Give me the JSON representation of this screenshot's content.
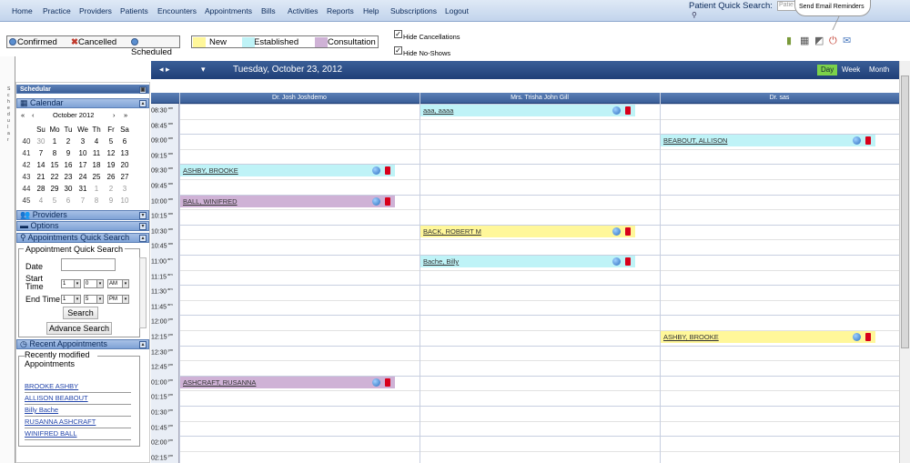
{
  "nav": {
    "items": [
      "Home",
      "Practice",
      "Providers",
      "Patients",
      "Encounters",
      "Appointments",
      "Bills",
      "Activities",
      "Reports",
      "Help",
      "Subscriptions",
      "Logout"
    ]
  },
  "patient_quick_search": {
    "label": "Patient Quick Search:",
    "placeholder": "Patie"
  },
  "tooltip": "Send Email Reminders",
  "legend_status": {
    "confirmed": "Confirmed",
    "cancelled": "Cancelled",
    "scheduled": "Scheduled"
  },
  "legend_types": {
    "new": "New",
    "established": "Established",
    "consultation": "Consultation"
  },
  "hide_cancellations": "Hide Cancellations",
  "hide_noshows": "Hide No-Shows",
  "left_strip_letters": [
    "S",
    "c",
    "h",
    "e",
    "d",
    "u",
    "l",
    "a",
    "r"
  ],
  "panel": {
    "scheduler": "Schedular",
    "calendar": "Calendar",
    "providers": "Providers",
    "options": "Options",
    "aqs": "Appointments Quick Search",
    "recent": "Recent Appointments"
  },
  "calendar": {
    "month": "October 2012",
    "nav": [
      "«",
      "‹",
      "›",
      "»"
    ],
    "days": [
      "Su",
      "Mo",
      "Tu",
      "We",
      "Th",
      "Fr",
      "Sa"
    ],
    "weeks": [
      {
        "wk": "40",
        "d": [
          "30",
          "1",
          "2",
          "3",
          "4",
          "5",
          "6"
        ]
      },
      {
        "wk": "41",
        "d": [
          "7",
          "8",
          "9",
          "10",
          "11",
          "12",
          "13"
        ]
      },
      {
        "wk": "42",
        "d": [
          "14",
          "15",
          "16",
          "17",
          "18",
          "19",
          "20"
        ]
      },
      {
        "wk": "43",
        "d": [
          "21",
          "22",
          "23",
          "24",
          "25",
          "26",
          "27"
        ]
      },
      {
        "wk": "44",
        "d": [
          "28",
          "29",
          "30",
          "31",
          "1",
          "2",
          "3"
        ]
      },
      {
        "wk": "45",
        "d": [
          "4",
          "5",
          "6",
          "7",
          "8",
          "9",
          "10"
        ]
      }
    ]
  },
  "quick_search": {
    "title": "Appointment Quick Search",
    "date": "Date",
    "start": "Start Time",
    "end": "End Time",
    "start_h": "1",
    "start_m": "0",
    "start_ap": "AM",
    "end_h": "1",
    "end_m": "5",
    "end_ap": "PM",
    "search": "Search",
    "advance": "Advance Search"
  },
  "recent": {
    "subtitle": "Recently modified Appointments",
    "items": [
      "BROOKE ASHBY",
      "ALLISON BEABOUT",
      "Billy Bache",
      "RUSANNA ASHCRAFT",
      "WINIFRED BALL"
    ]
  },
  "schedule": {
    "nav": "◂ ▸",
    "dropdown": "▾",
    "date": "Tuesday, October 23, 2012",
    "views": [
      "Day",
      "Week",
      "Month"
    ],
    "providers": [
      "Dr. Josh Joshdemo",
      "Mrs. Trisha John Gill",
      "Dr. sas"
    ],
    "times": [
      {
        "t": "08:30",
        "ap": "am"
      },
      {
        "t": "08:45",
        "ap": "am"
      },
      {
        "t": "09:00",
        "ap": "am"
      },
      {
        "t": "09:15",
        "ap": "am"
      },
      {
        "t": "09:30",
        "ap": "am"
      },
      {
        "t": "09:45",
        "ap": "am"
      },
      {
        "t": "10:00",
        "ap": "am"
      },
      {
        "t": "10:15",
        "ap": "am"
      },
      {
        "t": "10:30",
        "ap": "am"
      },
      {
        "t": "10:45",
        "ap": "am"
      },
      {
        "t": "11:00",
        "ap": "am"
      },
      {
        "t": "11:15",
        "ap": "am"
      },
      {
        "t": "11:30",
        "ap": "am"
      },
      {
        "t": "11:45",
        "ap": "am"
      },
      {
        "t": "12:00",
        "ap": "pm"
      },
      {
        "t": "12:15",
        "ap": "pm"
      },
      {
        "t": "12:30",
        "ap": "pm"
      },
      {
        "t": "12:45",
        "ap": "pm"
      },
      {
        "t": "01:00",
        "ap": "pm"
      },
      {
        "t": "01:15",
        "ap": "pm"
      },
      {
        "t": "01:30",
        "ap": "pm"
      },
      {
        "t": "01:45",
        "ap": "pm"
      },
      {
        "t": "02:00",
        "ap": "pm"
      },
      {
        "t": "02:15",
        "ap": "pm"
      }
    ],
    "appointments": [
      {
        "name": "aaa, aaaa",
        "provider": 1,
        "time": "08:30",
        "type": "established"
      },
      {
        "name": "BEABOUT, ALLISON",
        "provider": 2,
        "time": "09:00",
        "type": "established"
      },
      {
        "name": "ASHBY, BROOKE",
        "provider": 0,
        "time": "09:30",
        "type": "established"
      },
      {
        "name": "BALL, WINIFRED",
        "provider": 0,
        "time": "10:00",
        "type": "consultation"
      },
      {
        "name": "BACK, ROBERT M",
        "provider": 1,
        "time": "10:30",
        "type": "new"
      },
      {
        "name": "Bache, Billy",
        "provider": 1,
        "time": "11:00",
        "type": "established"
      },
      {
        "name": "ASHBY, BROOKE",
        "provider": 2,
        "time": "12:15",
        "type": "new"
      },
      {
        "name": "ASHCRAFT, RUSANNA",
        "provider": 0,
        "time": "01:00",
        "type": "consultation"
      }
    ]
  },
  "colors": {
    "new": "#fff79a",
    "established": "#bff3f7",
    "consultation": "#cfb2d6",
    "header": "#3b5f98",
    "nav": "#c2d4ec",
    "active_view": "#7bd24a"
  }
}
